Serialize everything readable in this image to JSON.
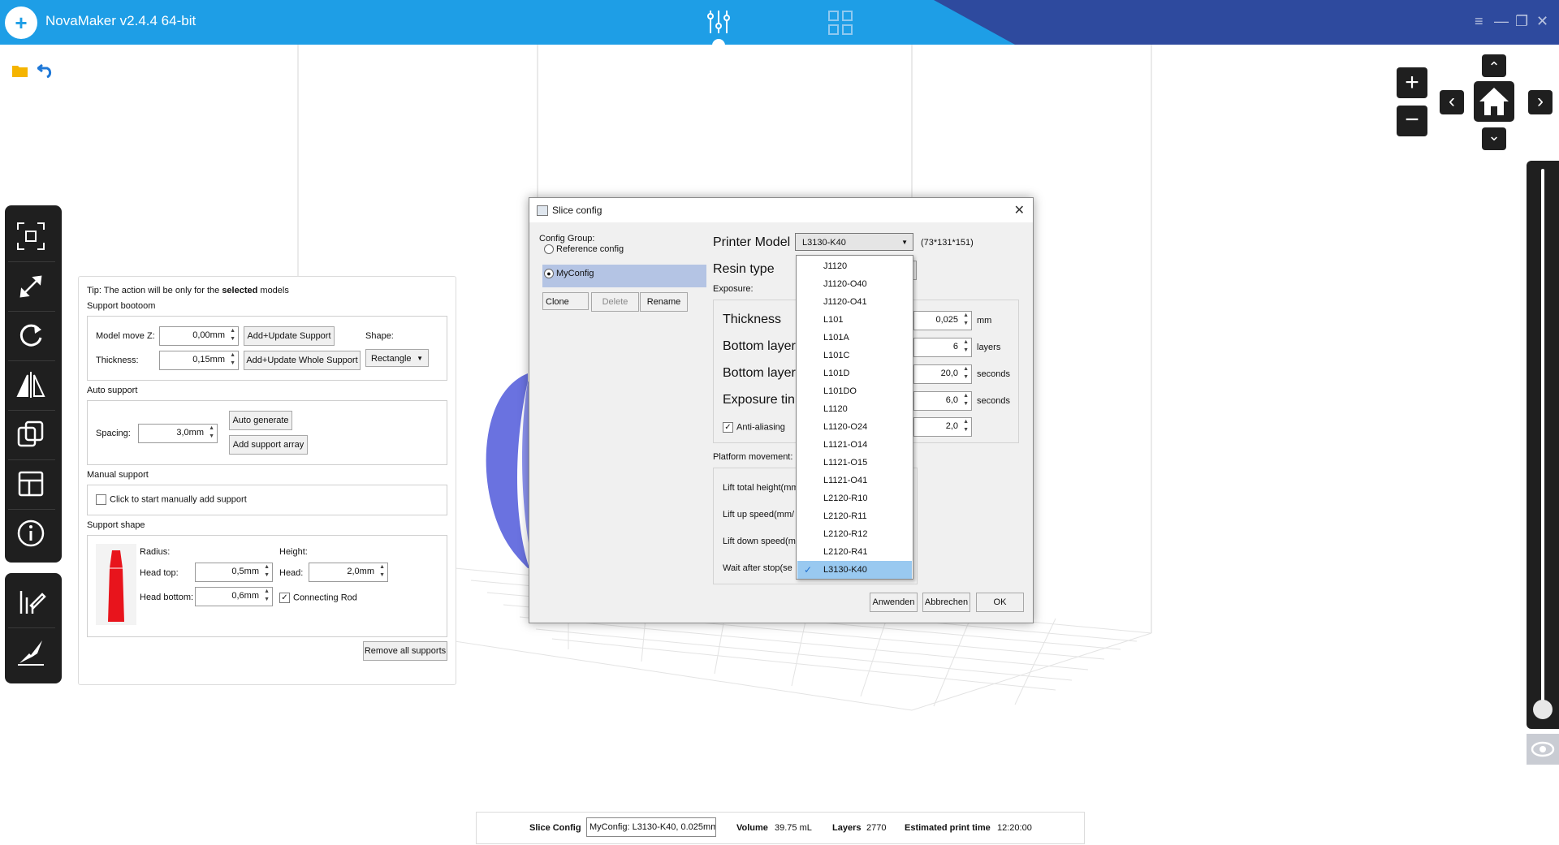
{
  "app": {
    "logo_glyph": "+",
    "title": "NovaMaker v2.4.4 64-bit"
  },
  "top_icons": {
    "slice_settings": "sliders-icon",
    "layout": "grid-icon"
  },
  "window_controls": {
    "menu": "≡",
    "minimize": "—",
    "maximize": "❐",
    "close": "✕"
  },
  "view_nav": {
    "zoom_in": "+",
    "zoom_out": "−",
    "up": "⌃",
    "down": "⌄",
    "left": "‹",
    "right": "›",
    "home": "home-icon"
  },
  "support_panel": {
    "tip_prefix": "Tip: The action will be only for the ",
    "tip_bold": "selected",
    "tip_suffix": " models",
    "support_bottom": {
      "title": "Support bootoom",
      "model_move_z_label": "Model move Z:",
      "model_move_z_value": "0,00mm",
      "thickness_label": "Thickness:",
      "thickness_value": "0,15mm",
      "add_update_support": "Add+Update Support",
      "add_update_whole_support": "Add+Update Whole Support",
      "shape_label": "Shape:",
      "shape_value": "Rectangle"
    },
    "auto_support": {
      "title": "Auto support",
      "spacing_label": "Spacing:",
      "spacing_value": "3,0mm",
      "auto_generate": "Auto generate",
      "add_support_array": "Add support array"
    },
    "manual_support": {
      "title": "Manual support",
      "checkbox_label": "Click to start manually add support"
    },
    "support_shape": {
      "title": "Support shape",
      "radius_label": "Radius:",
      "height_label": "Height:",
      "head_top_label": "Head top:",
      "head_top_value": "0,5mm",
      "head_label": "Head:",
      "head_value": "2,0mm",
      "head_bottom_label": "Head bottom:",
      "head_bottom_value": "0,6mm",
      "connecting_rod_label": "Connecting Rod",
      "connecting_rod_checked": "✓"
    },
    "remove_all_supports": "Remove all supports"
  },
  "dialog": {
    "title": "Slice config",
    "config_group_label": "Config Group:",
    "reference_config": "Reference config",
    "my_config": "MyConfig",
    "clone": "Clone",
    "delete": "Delete",
    "rename": "Rename",
    "printer_model_label": "Printer Model",
    "printer_model_value": "L3130-K40",
    "printer_dimensions": "(73*131*151)",
    "resin_type_label": "Resin type",
    "exposure_label": "Exposure:",
    "thickness_label": "Thickness",
    "thickness_value": "0,025",
    "thickness_unit": "mm",
    "bottom_layers_label": "Bottom layer",
    "bottom_layers_value": "6",
    "bottom_layers_unit": "layers",
    "bottom_exposure_label": "Bottom layer",
    "bottom_exposure_value": "20,0",
    "bottom_exposure_unit": "seconds",
    "exposure_time_label": "Exposure tin",
    "exposure_time_value": "6,0",
    "exposure_time_unit": "seconds",
    "anti_aliasing_label": "Anti-aliasing",
    "anti_aliasing_checked": "✓",
    "anti_aliasing_value": "2,0",
    "platform_movement_label": "Platform movement:",
    "lift_total_height_label": "Lift total height(mm",
    "lift_up_speed_label": "Lift up speed(mm/",
    "lift_down_speed_label": "Lift down speed(m",
    "wait_after_stop_label": "Wait after stop(se",
    "apply": "Anwenden",
    "cancel": "Abbrechen",
    "ok": "OK",
    "dropdown_items": [
      "J1120",
      "J1120-O40",
      "J1120-O41",
      "L101",
      "L101A",
      "L101C",
      "L101D",
      "L101DO",
      "L1120",
      "L1120-O24",
      "L1121-O14",
      "L1121-O15",
      "L1121-O41",
      "L2120-R10",
      "L2120-R11",
      "L2120-R12",
      "L2120-R41",
      "L3130-K40"
    ],
    "dropdown_selected_index": 17
  },
  "status_bar": {
    "slice_config_label": "Slice Config",
    "slice_config_value": "MyConfig: L3130-K40, 0.025mm",
    "volume_label": "Volume",
    "volume_value": "39.75 mL",
    "layers_label": "Layers",
    "layers_value": "2770",
    "print_time_label": "Estimated print time",
    "print_time_value": "12:20:00"
  },
  "colors": {
    "accent": "#1e9ee6",
    "title_dark": "#2e4a9e",
    "model": "#6a72e0",
    "support_red": "#e8141c",
    "selection": "#99c9f0"
  }
}
